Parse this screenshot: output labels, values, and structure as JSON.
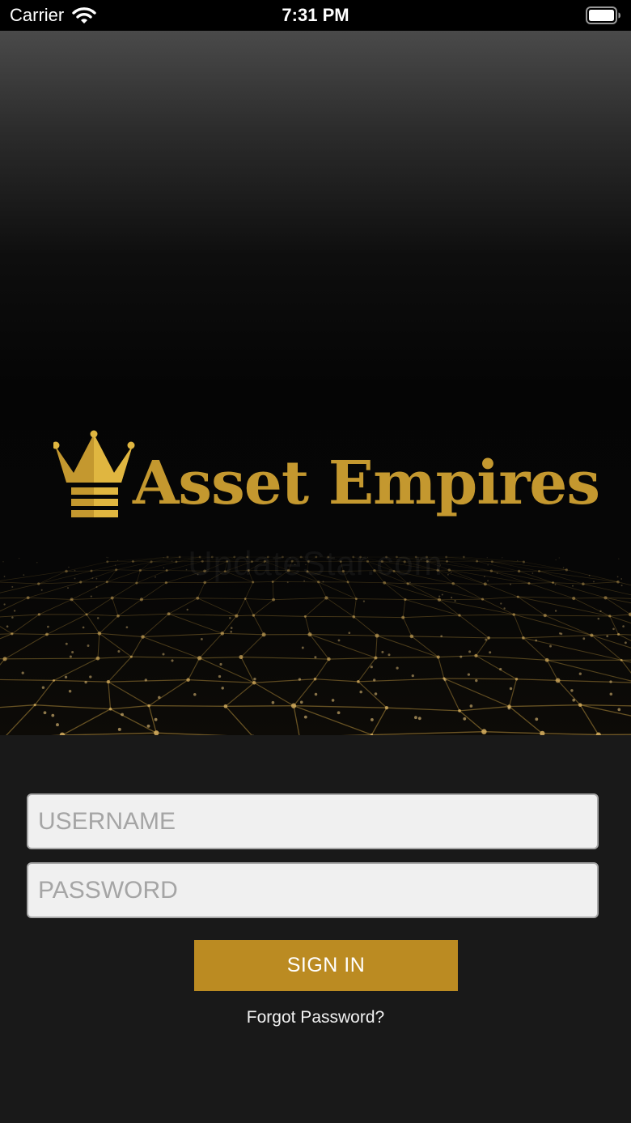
{
  "status_bar": {
    "carrier": "Carrier",
    "time": "7:31 PM",
    "icons": [
      "wifi-icon",
      "battery-icon"
    ]
  },
  "hero": {
    "brand_name": "Asset Empires",
    "watermark": "UpdateStar.com",
    "logo_icon": "crown-icon",
    "colors": {
      "gold": "#c4982f",
      "gold_light": "#e0b640"
    }
  },
  "login_form": {
    "username_placeholder": "USERNAME",
    "password_placeholder": "PASSWORD",
    "sign_in_label": "SIGN IN",
    "forgot_password_label": "Forgot Password?",
    "colors": {
      "button": "#bb8b22",
      "background": "#191919"
    }
  }
}
